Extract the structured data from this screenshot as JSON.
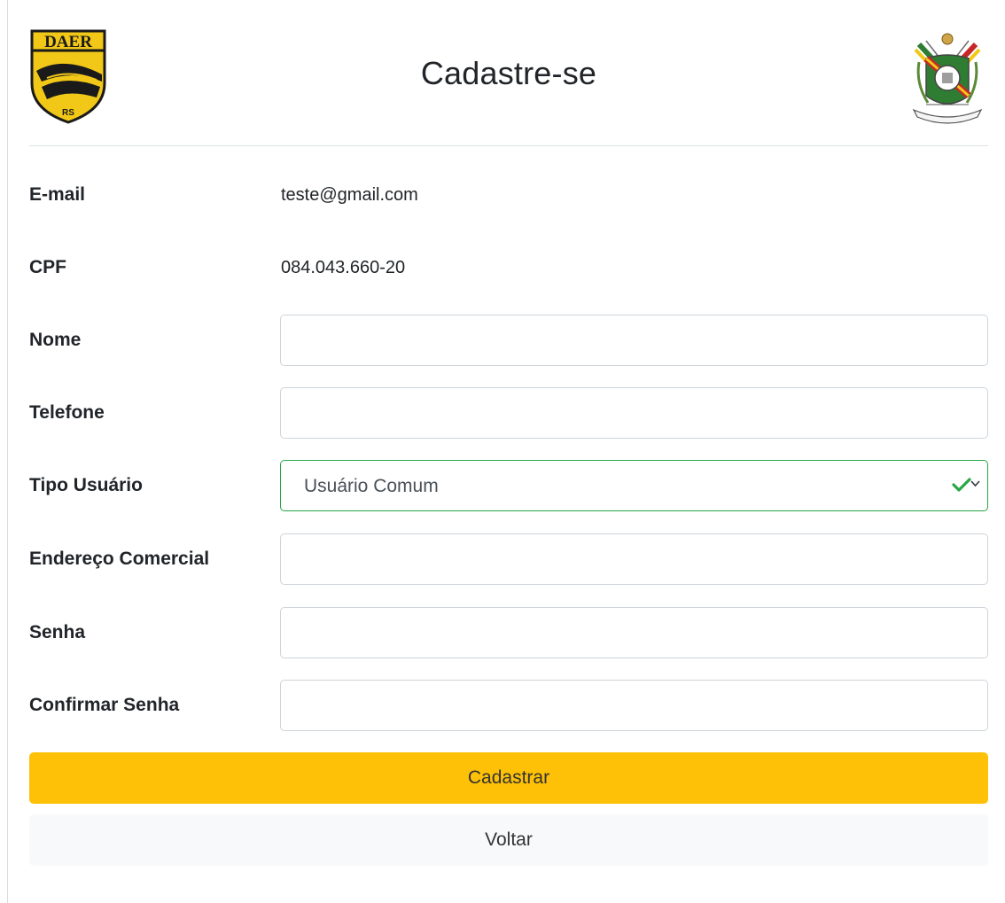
{
  "header": {
    "title": "Cadastre-se",
    "logo_left_text": "DAER",
    "logo_left_sub": "RS",
    "logo_left_icon": "daer-logo-icon",
    "logo_right_icon": "rs-coat-of-arms-icon"
  },
  "form": {
    "email": {
      "label": "E-mail",
      "value": "teste@gmail.com"
    },
    "cpf": {
      "label": "CPF",
      "value": "084.043.660-20"
    },
    "nome": {
      "label": "Nome",
      "value": ""
    },
    "telefone": {
      "label": "Telefone",
      "value": ""
    },
    "tipo_usuario": {
      "label": "Tipo Usuário",
      "selected": "Usuário Comum"
    },
    "endereco": {
      "label": "Endereço Comercial",
      "value": ""
    },
    "senha": {
      "label": "Senha",
      "value": ""
    },
    "confirmar_senha": {
      "label": "Confirmar Senha",
      "value": ""
    }
  },
  "actions": {
    "submit_label": "Cadastrar",
    "back_label": "Voltar"
  },
  "colors": {
    "primary": "#ffc107",
    "secondary": "#f8f9fa",
    "valid": "#28a745",
    "border": "#ced4da",
    "divider": "#dee2e6"
  }
}
